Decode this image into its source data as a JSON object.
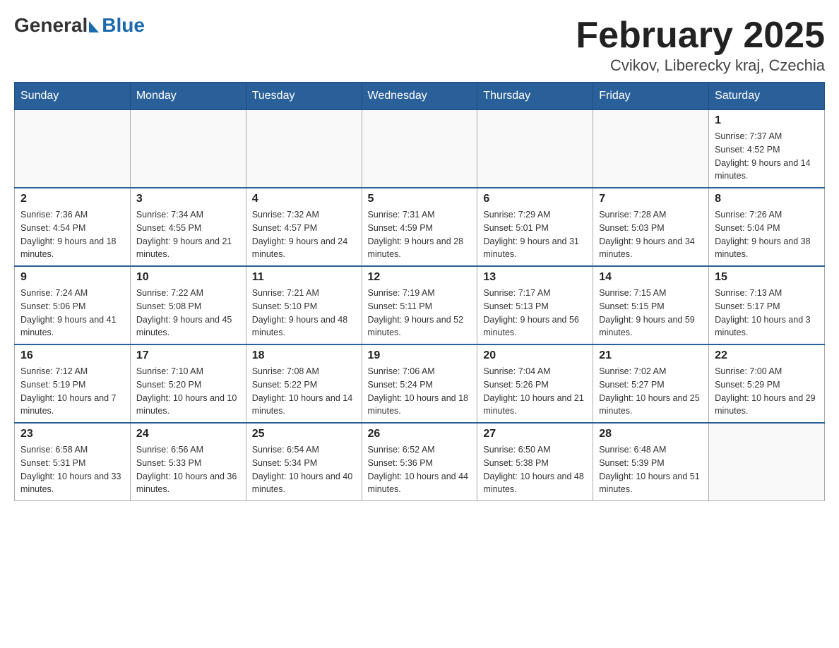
{
  "header": {
    "logo_general": "General",
    "logo_blue": "Blue",
    "month_title": "February 2025",
    "location": "Cvikov, Liberecky kraj, Czechia"
  },
  "weekdays": [
    "Sunday",
    "Monday",
    "Tuesday",
    "Wednesday",
    "Thursday",
    "Friday",
    "Saturday"
  ],
  "weeks": [
    [
      {
        "day": "",
        "info": ""
      },
      {
        "day": "",
        "info": ""
      },
      {
        "day": "",
        "info": ""
      },
      {
        "day": "",
        "info": ""
      },
      {
        "day": "",
        "info": ""
      },
      {
        "day": "",
        "info": ""
      },
      {
        "day": "1",
        "info": "Sunrise: 7:37 AM\nSunset: 4:52 PM\nDaylight: 9 hours and 14 minutes."
      }
    ],
    [
      {
        "day": "2",
        "info": "Sunrise: 7:36 AM\nSunset: 4:54 PM\nDaylight: 9 hours and 18 minutes."
      },
      {
        "day": "3",
        "info": "Sunrise: 7:34 AM\nSunset: 4:55 PM\nDaylight: 9 hours and 21 minutes."
      },
      {
        "day": "4",
        "info": "Sunrise: 7:32 AM\nSunset: 4:57 PM\nDaylight: 9 hours and 24 minutes."
      },
      {
        "day": "5",
        "info": "Sunrise: 7:31 AM\nSunset: 4:59 PM\nDaylight: 9 hours and 28 minutes."
      },
      {
        "day": "6",
        "info": "Sunrise: 7:29 AM\nSunset: 5:01 PM\nDaylight: 9 hours and 31 minutes."
      },
      {
        "day": "7",
        "info": "Sunrise: 7:28 AM\nSunset: 5:03 PM\nDaylight: 9 hours and 34 minutes."
      },
      {
        "day": "8",
        "info": "Sunrise: 7:26 AM\nSunset: 5:04 PM\nDaylight: 9 hours and 38 minutes."
      }
    ],
    [
      {
        "day": "9",
        "info": "Sunrise: 7:24 AM\nSunset: 5:06 PM\nDaylight: 9 hours and 41 minutes."
      },
      {
        "day": "10",
        "info": "Sunrise: 7:22 AM\nSunset: 5:08 PM\nDaylight: 9 hours and 45 minutes."
      },
      {
        "day": "11",
        "info": "Sunrise: 7:21 AM\nSunset: 5:10 PM\nDaylight: 9 hours and 48 minutes."
      },
      {
        "day": "12",
        "info": "Sunrise: 7:19 AM\nSunset: 5:11 PM\nDaylight: 9 hours and 52 minutes."
      },
      {
        "day": "13",
        "info": "Sunrise: 7:17 AM\nSunset: 5:13 PM\nDaylight: 9 hours and 56 minutes."
      },
      {
        "day": "14",
        "info": "Sunrise: 7:15 AM\nSunset: 5:15 PM\nDaylight: 9 hours and 59 minutes."
      },
      {
        "day": "15",
        "info": "Sunrise: 7:13 AM\nSunset: 5:17 PM\nDaylight: 10 hours and 3 minutes."
      }
    ],
    [
      {
        "day": "16",
        "info": "Sunrise: 7:12 AM\nSunset: 5:19 PM\nDaylight: 10 hours and 7 minutes."
      },
      {
        "day": "17",
        "info": "Sunrise: 7:10 AM\nSunset: 5:20 PM\nDaylight: 10 hours and 10 minutes."
      },
      {
        "day": "18",
        "info": "Sunrise: 7:08 AM\nSunset: 5:22 PM\nDaylight: 10 hours and 14 minutes."
      },
      {
        "day": "19",
        "info": "Sunrise: 7:06 AM\nSunset: 5:24 PM\nDaylight: 10 hours and 18 minutes."
      },
      {
        "day": "20",
        "info": "Sunrise: 7:04 AM\nSunset: 5:26 PM\nDaylight: 10 hours and 21 minutes."
      },
      {
        "day": "21",
        "info": "Sunrise: 7:02 AM\nSunset: 5:27 PM\nDaylight: 10 hours and 25 minutes."
      },
      {
        "day": "22",
        "info": "Sunrise: 7:00 AM\nSunset: 5:29 PM\nDaylight: 10 hours and 29 minutes."
      }
    ],
    [
      {
        "day": "23",
        "info": "Sunrise: 6:58 AM\nSunset: 5:31 PM\nDaylight: 10 hours and 33 minutes."
      },
      {
        "day": "24",
        "info": "Sunrise: 6:56 AM\nSunset: 5:33 PM\nDaylight: 10 hours and 36 minutes."
      },
      {
        "day": "25",
        "info": "Sunrise: 6:54 AM\nSunset: 5:34 PM\nDaylight: 10 hours and 40 minutes."
      },
      {
        "day": "26",
        "info": "Sunrise: 6:52 AM\nSunset: 5:36 PM\nDaylight: 10 hours and 44 minutes."
      },
      {
        "day": "27",
        "info": "Sunrise: 6:50 AM\nSunset: 5:38 PM\nDaylight: 10 hours and 48 minutes."
      },
      {
        "day": "28",
        "info": "Sunrise: 6:48 AM\nSunset: 5:39 PM\nDaylight: 10 hours and 51 minutes."
      },
      {
        "day": "",
        "info": ""
      }
    ]
  ]
}
